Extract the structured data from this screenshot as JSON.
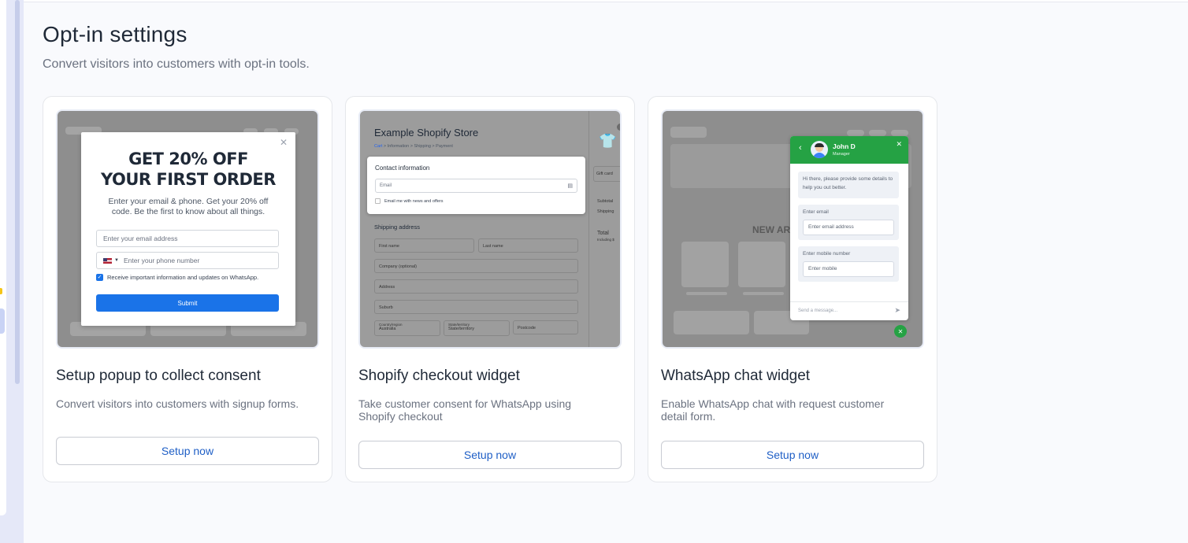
{
  "page": {
    "title": "Opt-in settings",
    "subtitle": "Convert visitors into customers with opt-in tools."
  },
  "cards": [
    {
      "title": "Setup popup to collect consent",
      "description": "Convert visitors into customers with signup forms.",
      "button": "Setup now",
      "preview": {
        "headline_1": "GET 20% OFF",
        "headline_2": "YOUR FIRST ORDER",
        "body": "Enter your email & phone. Get your 20% off code. Be the first to know about all things.",
        "email_placeholder": "Enter your email address",
        "phone_placeholder": "Enter your phone number",
        "checkbox_label": "Receive important information and updates on WhatsApp.",
        "submit": "Submit",
        "close_icon": "close-icon"
      }
    },
    {
      "title": "Shopify checkout widget",
      "description": "Take customer consent for WhatsApp using Shopify checkout",
      "button": "Setup now",
      "preview": {
        "store_name": "Example Shopify Store",
        "breadcrumb": [
          "Cart",
          "Information",
          "Shipping",
          "Payment"
        ],
        "contact_title": "Contact information",
        "email_placeholder": "Email",
        "news_checkbox": "Email me with news and offers",
        "shipping_title": "Shipping address",
        "first_name": "First name",
        "last_name": "Last name",
        "company": "Company (optional)",
        "address": "Address",
        "suburb": "Suburb",
        "country_label": "Country/region",
        "country_value": "Australia",
        "state_label": "State/territory",
        "state_value": "State/territory",
        "postcode": "Postcode",
        "gift_card": "Gift card",
        "subtotal": "Subtotal",
        "shipping": "Shipping",
        "total": "Total",
        "including": "Including $"
      }
    },
    {
      "title": "WhatsApp chat widget",
      "description": "Enable WhatsApp chat with request customer detail form.",
      "button": "Setup now",
      "preview": {
        "agent_name": "John D",
        "agent_role": "Manager",
        "greeting": "Hi there, please provide some details to help you out better.",
        "email_label": "Enter email",
        "email_placeholder": "Enter email address",
        "mobile_label": "Enter mobile number",
        "mobile_placeholder": "Enter mobile",
        "message_placeholder": "Send a message...",
        "background_banner": "NEW AR"
      }
    }
  ]
}
